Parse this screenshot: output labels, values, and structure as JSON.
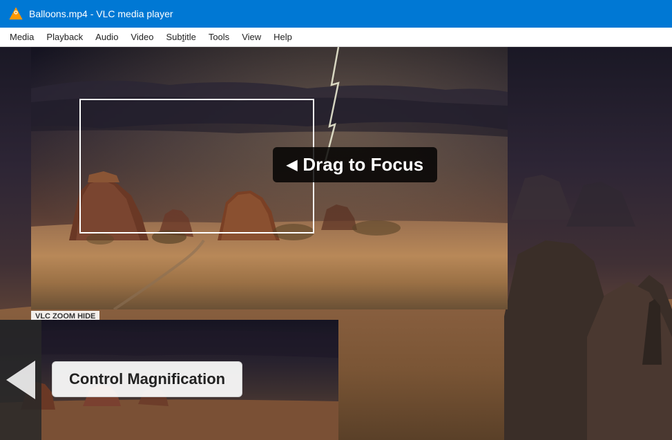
{
  "titleBar": {
    "title": "Balloons.mp4 - VLC media player",
    "logo": "vlc-cone-icon"
  },
  "menuBar": {
    "items": [
      {
        "label": "Media",
        "underlineIndex": 0
      },
      {
        "label": "Playback",
        "underlineIndex": 0
      },
      {
        "label": "Audio",
        "underlineIndex": 0
      },
      {
        "label": "Video",
        "underlineIndex": 0
      },
      {
        "label": "Subtitle",
        "underlineIndex": 3
      },
      {
        "label": "Tools",
        "underlineIndex": 0
      },
      {
        "label": "View",
        "underlineIndex": 0
      },
      {
        "label": "Help",
        "underlineIndex": 0
      }
    ]
  },
  "overlay": {
    "dragToFocusLabel": "Drag to Focus",
    "controlMagnificationLabel": "Control Magnification",
    "zoomHideLabel": "VLC ZOOM HIDE"
  },
  "colors": {
    "titleBarBg": "#0078d4",
    "titleBarText": "#ffffff",
    "menuBarBg": "#ffffff",
    "tooltipBg": "rgba(0,0,0,0.82)",
    "tooltipText": "#ffffff",
    "controlMagBg": "rgba(255,255,255,0.92)",
    "controlMagText": "#222222"
  }
}
